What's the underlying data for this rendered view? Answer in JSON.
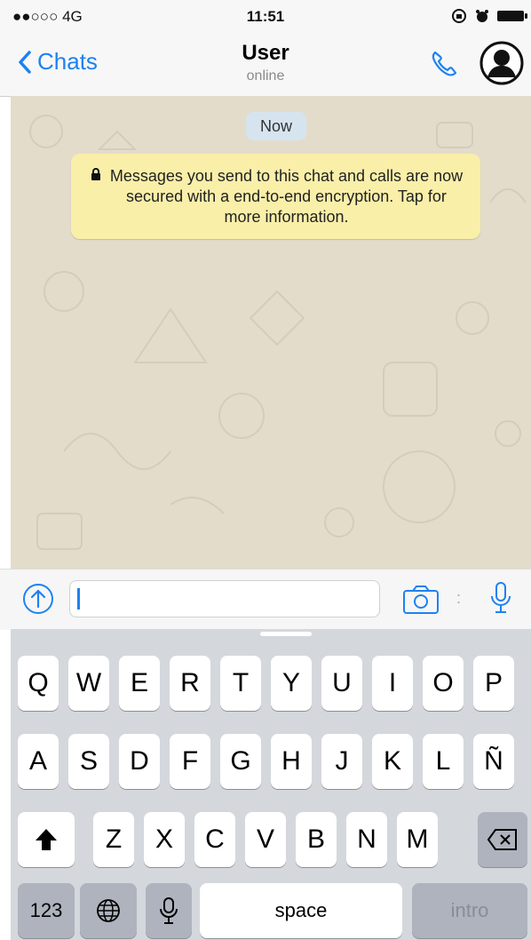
{
  "status": {
    "carrier": "●●○○○ 4G",
    "time": "11:51"
  },
  "nav": {
    "back_label": "Chats",
    "title": "User",
    "subtitle": "online"
  },
  "chat": {
    "date_label": "Now",
    "notice": "Messages you send to this chat and calls are now secured with a end-to-end encryption. Tap for more information."
  },
  "keyboard": {
    "row1": [
      "Q",
      "W",
      "E",
      "R",
      "T",
      "Y",
      "U",
      "I",
      "O",
      "P"
    ],
    "row2": [
      "A",
      "S",
      "D",
      "F",
      "G",
      "H",
      "J",
      "K",
      "L",
      "Ñ"
    ],
    "row3": [
      "Z",
      "X",
      "C",
      "V",
      "B",
      "N",
      "M"
    ],
    "numbers_label": "123",
    "space_label": "space",
    "return_label": "intro"
  },
  "colors": {
    "accent": "#1d82f2",
    "notice_bg": "#f9efa9",
    "chat_bg": "#e3dccb"
  },
  "icons": [
    "chevron-left-icon",
    "phone-icon",
    "avatar-icon",
    "lock-icon",
    "upload-icon",
    "camera-icon",
    "microphone-icon",
    "shift-icon",
    "backspace-icon",
    "globe-icon"
  ]
}
